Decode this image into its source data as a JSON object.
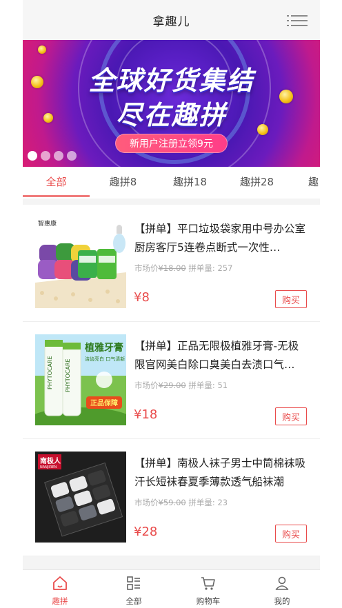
{
  "header": {
    "title": "拿趣儿",
    "menu_icon": "list-menu-icon"
  },
  "banner": {
    "line1": "全球好货集结",
    "line2": "尽在趣拼",
    "promo": "新用户注册立领9元",
    "slides": 4,
    "active_slide": 1
  },
  "tabs": [
    {
      "label": "全部"
    },
    {
      "label": "趣拼8"
    },
    {
      "label": "趣拼18"
    },
    {
      "label": "趣拼28"
    },
    {
      "label": "趣"
    }
  ],
  "products": [
    {
      "title": "【拼单】平口垃圾袋家用中号办公室厨房客厅5连卷点断式一次性…",
      "market_label": "市场价",
      "market_price": "¥18.00",
      "group_label": "拼单量:",
      "group_count": "257",
      "price": "¥8",
      "buy_label": "购买",
      "image_brand": "智惠康"
    },
    {
      "title": "【拼单】正品无限极植雅牙膏-无极限官网美白除口臭美白去渍口气…",
      "market_label": "市场价",
      "market_price": "¥29.00",
      "group_label": "拼单量:",
      "group_count": "51",
      "price": "¥18",
      "buy_label": "购买",
      "image_brand": "植雅牙膏",
      "image_sub": "洁齿亮白 口气清新",
      "image_badge": "正品保障",
      "image_tube": "PHYTOCARE"
    },
    {
      "title": "【拼单】南极人袜子男士中筒棉袜吸汗长短袜春夏季薄款透气船袜潮",
      "market_label": "市场价",
      "market_price": "¥59.00",
      "group_label": "拼单量:",
      "group_count": "23",
      "price": "¥28",
      "buy_label": "购买",
      "image_brand": "南极人",
      "image_brand_en": "NANJIREN"
    }
  ],
  "bottom_nav": [
    {
      "label": "趣拼",
      "icon": "home-icon",
      "active": true
    },
    {
      "label": "全部",
      "icon": "category-icon",
      "active": false
    },
    {
      "label": "购物车",
      "icon": "cart-icon",
      "active": false
    },
    {
      "label": "我的",
      "icon": "user-icon",
      "active": false
    }
  ],
  "colors": {
    "accent": "#e94b4b",
    "header_bg": "#f6f6f6",
    "page_bg": "#f4f4f4"
  }
}
